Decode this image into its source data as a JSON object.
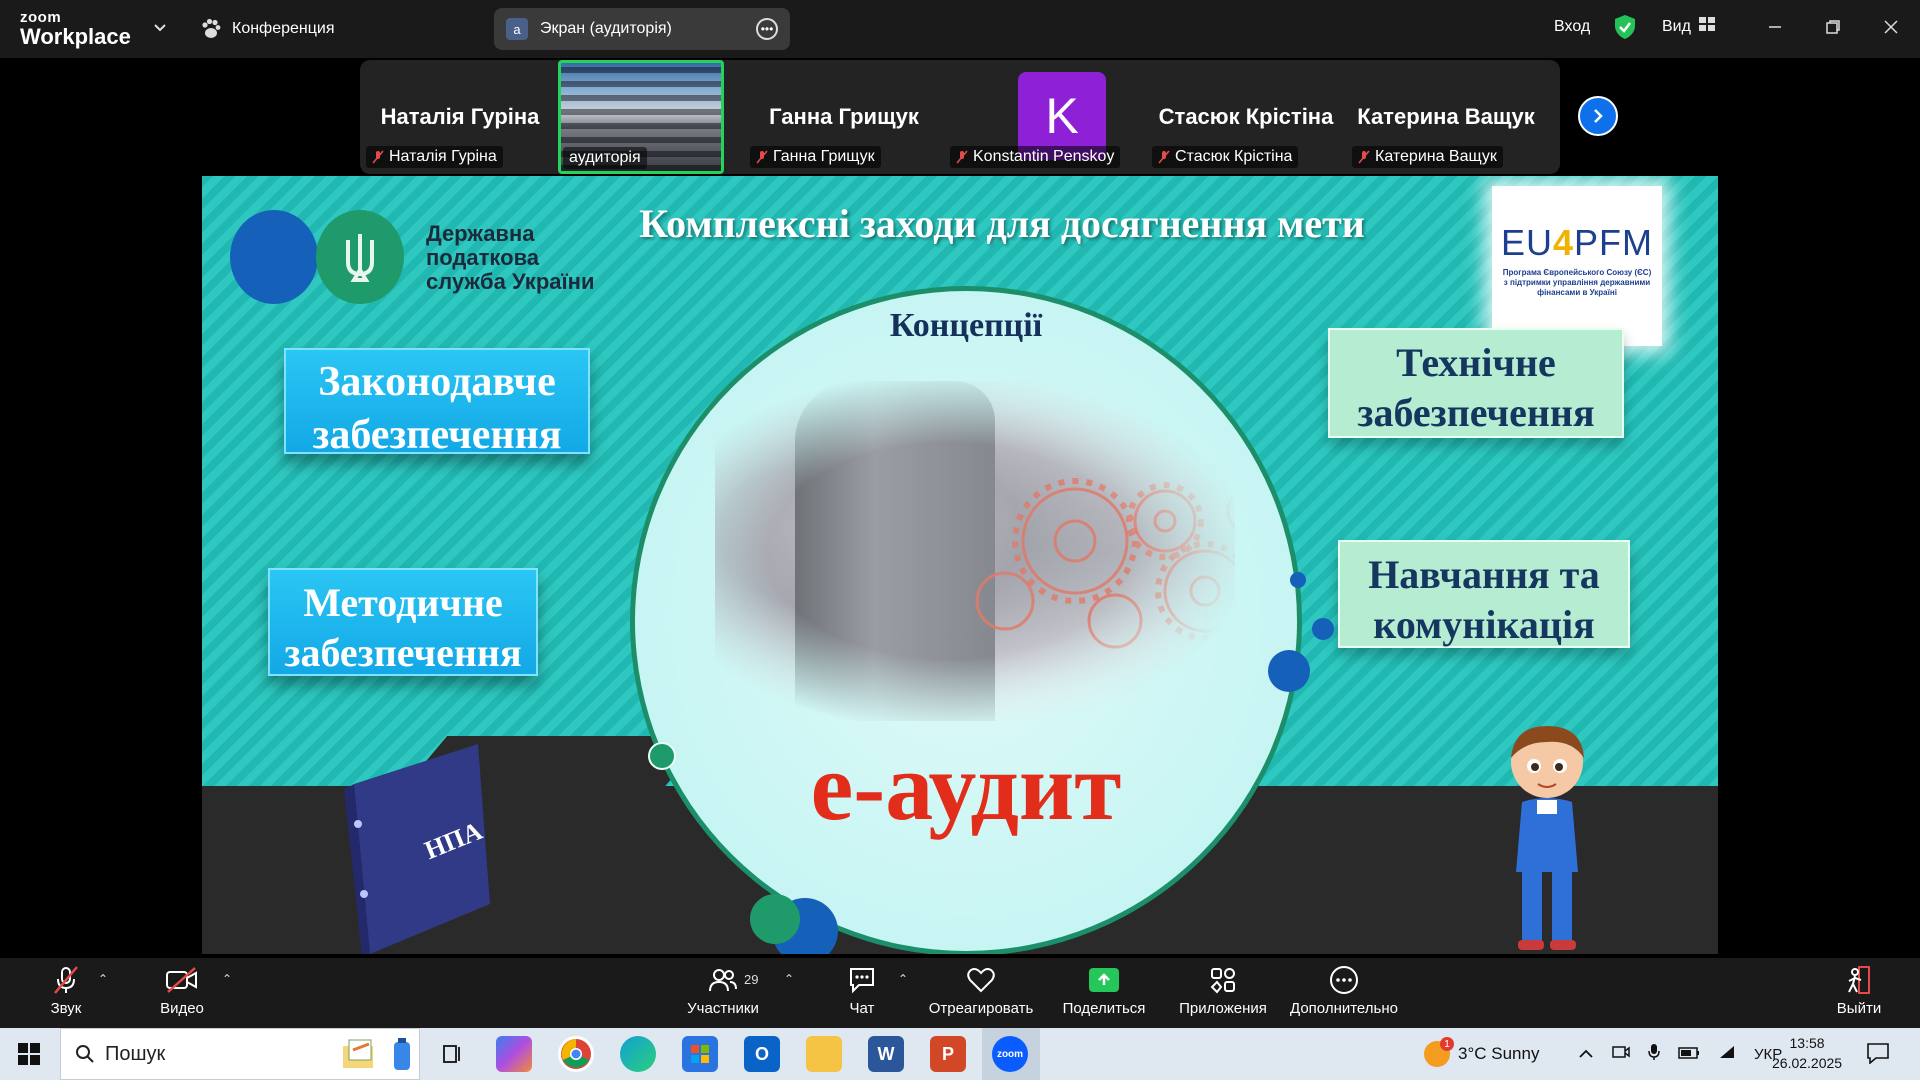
{
  "app": {
    "logo_small": "zoom",
    "logo_big": "Workplace",
    "meeting_label": "Конференция",
    "screen_pill": {
      "avatar_letter": "a",
      "label": "Экран (аудиторія)"
    },
    "signin": "Вход",
    "view": "Вид"
  },
  "participants": [
    {
      "big_name": "Наталія Гуріна",
      "tag": "Наталія Гуріна",
      "muted": true
    },
    {
      "big_name": "",
      "tag": "аудиторія",
      "muted": false,
      "video": true
    },
    {
      "big_name": "Ганна Грищук",
      "tag": "Ганна Грищук",
      "muted": true
    },
    {
      "avatar_letter": "K",
      "tag": "Konstantin Penskoy",
      "muted": true
    },
    {
      "big_name": "Стасюк Крістіна",
      "tag": "Стасюк Крістіна",
      "muted": true
    },
    {
      "big_name": "Катерина Ващук",
      "tag": "Катерина Ващук",
      "muted": true
    }
  ],
  "slide": {
    "org_lines": [
      "Державна",
      "податкова",
      "служба України"
    ],
    "title": "Комплексні заходи для досягнення мети",
    "eu_logo": {
      "left": "EU",
      "four": "4",
      "right": "PFM"
    },
    "eu_subtitle": "Програма Європейського Союзу (ЄС) з підтримки управління державними фінансами в Україні",
    "concept": "Концепції",
    "center_text": "е-аудит",
    "box_legal": [
      "Законодавче",
      "забезпечення"
    ],
    "box_method": [
      "Методичне",
      "забезпечення"
    ],
    "box_tech": [
      "Технічне",
      "забезпечення"
    ],
    "box_training": [
      "Навчання та",
      "комунікація"
    ],
    "binder_label": "НПА",
    "colors": {
      "teal": "#2ec8c0",
      "red": "#e22d1b",
      "navy": "#16305c"
    }
  },
  "toolbar": {
    "audio": "Звук",
    "video": "Видео",
    "participants": "Участники",
    "participants_count": "29",
    "chat": "Чат",
    "react": "Отреагировать",
    "share": "Поделиться",
    "apps": "Приложения",
    "more": "Дополнительно",
    "leave": "Выйти"
  },
  "taskbar": {
    "search_placeholder": "Пошук",
    "weather_badge": "1",
    "weather": "3°C  Sunny",
    "lang": "УКР",
    "time": "13:58",
    "date": "26.02.2025"
  }
}
